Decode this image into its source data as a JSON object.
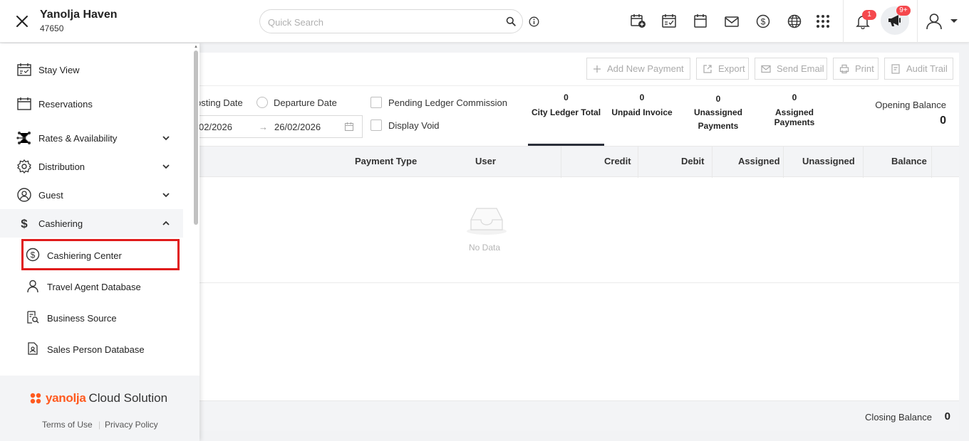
{
  "header": {
    "hotel_name": "Yanolja Haven",
    "hotel_id": "47650",
    "search_placeholder": "Quick Search",
    "notification_count": "1",
    "announcement_count": "9+",
    "icons": [
      "close-icon",
      "search-icon",
      "info-icon",
      "calendar-add-icon",
      "calendar-check-icon",
      "calendar-icon",
      "mail-icon",
      "dollar-icon",
      "globe-icon",
      "apps-grid-icon",
      "bell-icon",
      "megaphone-icon",
      "user-icon"
    ]
  },
  "sidebar": {
    "items": [
      {
        "label": "Stay View",
        "icon": "calendar-check-icon"
      },
      {
        "label": "Reservations",
        "icon": "calendar-icon"
      },
      {
        "label": "Rates & Availability",
        "icon": "network-icon",
        "expandable": true
      },
      {
        "label": "Distribution",
        "icon": "gear-icon",
        "expandable": true
      },
      {
        "label": "Guest",
        "icon": "guest-icon",
        "expandable": true
      },
      {
        "label": "Cashiering",
        "icon": "dollar-icon",
        "expanded": true
      }
    ],
    "subitems": [
      {
        "label": "Cashiering Center",
        "icon": "dollar-circle-icon",
        "highlighted": true
      },
      {
        "label": "Travel Agent Database",
        "icon": "person-icon"
      },
      {
        "label": "Business Source",
        "icon": "document-search-icon"
      },
      {
        "label": "Sales Person Database",
        "icon": "id-badge-icon"
      }
    ],
    "footer": {
      "brand_name": "yanolja",
      "brand_suffix": "Cloud Solution",
      "terms": "Terms of Use",
      "privacy": "Privacy Policy"
    }
  },
  "actions": {
    "add_payment": "Add New Payment",
    "export": "Export",
    "send_email": "Send Email",
    "print": "Print",
    "audit_trail": "Audit Trail"
  },
  "filters": {
    "posting_date": "osting Date",
    "departure_date": "Departure Date",
    "date_from": "02/2026",
    "date_to": "26/02/2026",
    "pending_ledger": "Pending Ledger Commission",
    "display_void": "Display Void"
  },
  "stats": [
    {
      "value": "0",
      "label": "City Ledger Total"
    },
    {
      "value": "0",
      "label": "Unpaid Invoice"
    },
    {
      "value": "0",
      "label": "Unassigned Payments"
    },
    {
      "value": "0",
      "label": "Assigned Payments"
    }
  ],
  "opening_balance": {
    "label": "Opening Balance",
    "value": "0"
  },
  "table": {
    "columns": [
      "Payment Type",
      "User",
      "Credit",
      "Debit",
      "Assigned",
      "Unassigned",
      "Balance"
    ],
    "empty_text": "No Data"
  },
  "closing_balance": {
    "label": "Closing Balance",
    "value": "0"
  },
  "colors": {
    "accent": "#2b2f3a",
    "brand": "#ff5a1f",
    "badge": "#f5484d",
    "highlight": "#e01b1b"
  }
}
